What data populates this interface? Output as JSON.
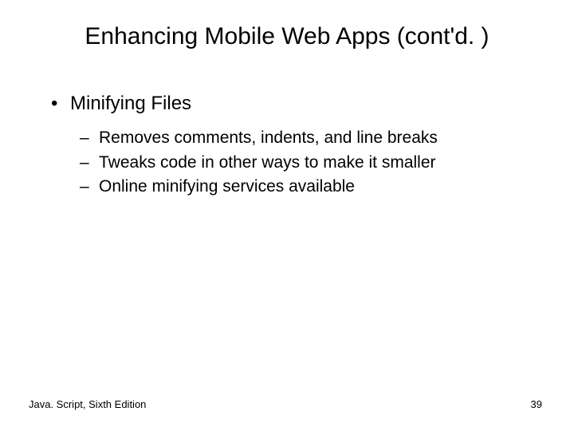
{
  "slide": {
    "title": "Enhancing Mobile Web Apps (cont'd. )",
    "bullets": {
      "item1": {
        "label": "Minifying Files",
        "sub1": "Removes comments, indents, and line breaks",
        "sub2": "Tweaks code in other ways to make it smaller",
        "sub3": "Online minifying services available"
      }
    },
    "footer_left": "Java. Script, Sixth Edition",
    "page_number": "39"
  }
}
